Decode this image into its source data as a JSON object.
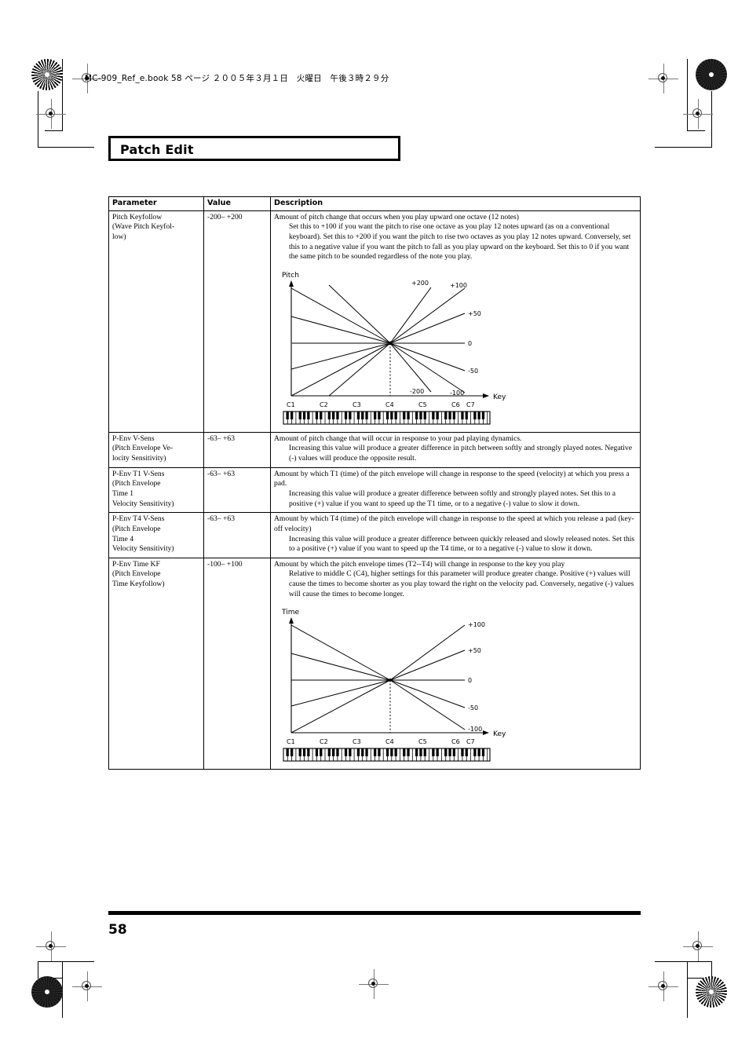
{
  "slug": "MC-909_Ref_e.book  58 ページ  ２００５年３月１日　火曜日　午後３時２９分",
  "title": "Patch Edit",
  "page_number": "58",
  "table": {
    "headers": [
      "Parameter",
      "Value",
      "Description"
    ],
    "rows": [
      {
        "parameter": "Pitch Keyfollow\n(Wave Pitch Keyfol-\nlow)",
        "value": "-200– +200",
        "desc_lead": "Amount of pitch change that occurs when you play upward one octave (12 notes)",
        "desc_indent": "Set this to +100 if you want the pitch to rise one octave as you play 12 notes upward (as on a conventional keyboard). Set this to +200 if you want the pitch to rise two octaves as you play 12 notes upward. Conversely, set this to a negative value if you want the pitch to fall as you play upward on the keyboard. Set this to 0 if you want the same pitch to be sounded regardless of the note you play.",
        "figure": "pitch-keyfollow-graph"
      },
      {
        "parameter": "P-Env V-Sens\n(Pitch Envelope Ve-\nlocity Sensitivity)",
        "value": "-63– +63",
        "desc_lead": "Amount of pitch change that will occur in response to your pad playing dynamics.",
        "desc_indent": "Increasing this value will produce a greater difference in pitch between softly and strongly played notes. Negative (-) values will produce the opposite result.",
        "figure": null
      },
      {
        "parameter": "P-Env T1 V-Sens\n(Pitch Envelope\nTime 1\nVelocity Sensitivity)",
        "value": "-63– +63",
        "desc_lead": "Amount by which T1 (time) of the pitch envelope will change in response to the speed (velocity) at which you press a pad.",
        "desc_indent": "Increasing this value will produce a greater difference between softly and strongly played notes. Set this to a positive (+) value if you want to speed up the T1 time, or to a negative (-) value to slow it down.",
        "figure": null
      },
      {
        "parameter": "P-Env T4 V-Sens\n(Pitch Envelope\nTime 4\nVelocity Sensitivity)",
        "value": "-63– +63",
        "desc_lead": "Amount by which T4 (time) of the pitch envelope will change in response to the speed at which you release a pad (key-off velocity)",
        "desc_indent": "Increasing this value will produce a greater difference between quickly released and slowly released notes. Set this to a positive (+) value if you want to speed up the T4 time, or to a negative (-) value to slow it down.",
        "figure": null
      },
      {
        "parameter": "P-Env Time KF\n(Pitch Envelope\nTime Keyfollow)",
        "value": "-100– +100",
        "desc_lead": "Amount by which the pitch envelope times (T2--T4) will change in response to the key you play",
        "desc_indent": "Relative to middle C (C4), higher settings for this parameter will produce greater change. Positive (+) values will cause the times to become shorter as you play toward the right on the velocity pad. Conversely, negative (-) values will cause the times to become longer.",
        "figure": "time-keyfollow-graph"
      }
    ]
  },
  "chart_data": [
    {
      "id": "pitch-keyfollow-graph",
      "type": "line",
      "title": "",
      "ylabel": "Pitch",
      "xlabel": "Key",
      "xticks": [
        "C1",
        "C2",
        "C3",
        "C4",
        "C5",
        "C6",
        "C7"
      ],
      "pivot_x": "C4",
      "grid": false,
      "legend": "right-edge-labels",
      "series": [
        {
          "name": "+200",
          "slope": 4.0,
          "label_pos": "upper-mid"
        },
        {
          "name": "+100",
          "slope": 2.0,
          "label_pos": "upper-right"
        },
        {
          "name": "+50",
          "slope": 1.0,
          "label_pos": "right"
        },
        {
          "name": "0",
          "slope": 0.0,
          "label_pos": "right-center"
        },
        {
          "name": "-50",
          "slope": -1.0,
          "label_pos": "right"
        },
        {
          "name": "-100",
          "slope": -2.0,
          "label_pos": "lower-right"
        },
        {
          "name": "-200",
          "slope": -4.0,
          "label_pos": "lower-mid"
        }
      ],
      "keyboard": true,
      "octaves": 7
    },
    {
      "id": "time-keyfollow-graph",
      "type": "line",
      "title": "",
      "ylabel": "Time",
      "xlabel": "Key",
      "xticks": [
        "C1",
        "C2",
        "C3",
        "C4",
        "C5",
        "C6",
        "C7"
      ],
      "pivot_x": "C4",
      "grid": false,
      "legend": "right-edge-labels",
      "series": [
        {
          "name": "+100",
          "slope": 2.0,
          "label_pos": "upper-right"
        },
        {
          "name": "+50",
          "slope": 1.0,
          "label_pos": "right"
        },
        {
          "name": "0",
          "slope": 0.0,
          "label_pos": "right-center"
        },
        {
          "name": "-50",
          "slope": -1.0,
          "label_pos": "right"
        },
        {
          "name": "-100",
          "slope": -2.0,
          "label_pos": "lower-right"
        }
      ],
      "keyboard": true,
      "octaves": 7
    }
  ]
}
